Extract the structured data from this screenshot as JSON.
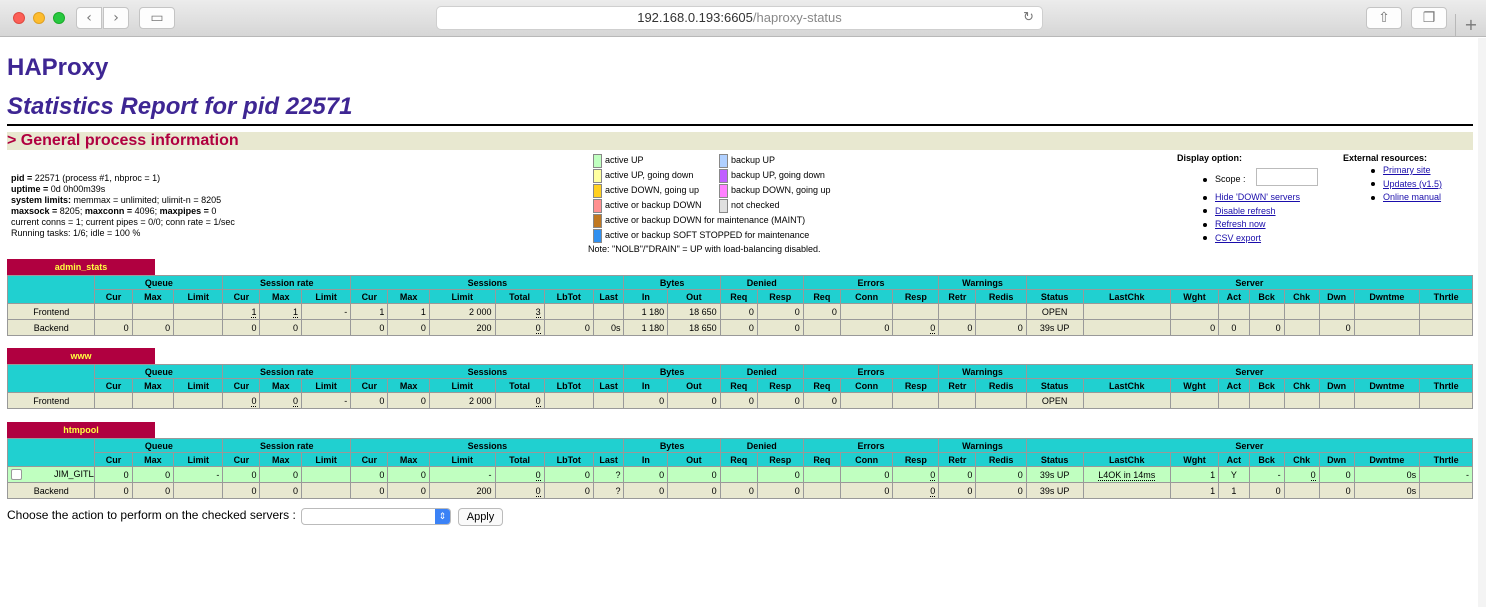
{
  "browser": {
    "url_host": "192.168.0.193:6605",
    "url_path": "/haproxy-status"
  },
  "page": {
    "title": "HAProxy",
    "subtitle": "Statistics Report for pid 22571",
    "section_title": "> General process information"
  },
  "process": {
    "line1_bold": "pid = ",
    "line1": "22571 (process #1, nbproc = 1)",
    "line2_bold": "uptime = ",
    "line2": "0d 0h00m39s",
    "line3_bold": "system limits:",
    "line3": " memmax = unlimited; ulimit-n = 8205",
    "line4_bold": "maxsock = ",
    "line4a": "8205; ",
    "line4b_bold": "maxconn = ",
    "line4b": "4096; ",
    "line4c_bold": "maxpipes = ",
    "line4c": "0",
    "line5": "current conns = 1; current pipes = 0/0; conn rate = 1/sec",
    "line6": "Running tasks: 1/6; idle = 100 %"
  },
  "legend": {
    "items_left": [
      {
        "label": "active UP",
        "color": "#c0ffc0"
      },
      {
        "label": "active UP, going down",
        "color": "#ffffa0"
      },
      {
        "label": "active DOWN, going up",
        "color": "#ffd020"
      },
      {
        "label": "active or backup DOWN",
        "color": "#ff9090"
      },
      {
        "label": "active or backup DOWN for maintenance (MAINT)",
        "color": "#c07820"
      },
      {
        "label": "active or backup SOFT STOPPED for maintenance",
        "color": "#3090f0"
      }
    ],
    "items_right": [
      {
        "label": "backup UP",
        "color": "#b0d0ff"
      },
      {
        "label": "backup UP, going down",
        "color": "#c060ff"
      },
      {
        "label": "backup DOWN, going up",
        "color": "#ff80ff"
      },
      {
        "label": "not checked",
        "color": "#e0e0e0"
      }
    ],
    "note": "Note: \"NOLB\"/\"DRAIN\" = UP with load-balancing disabled."
  },
  "display_option": {
    "heading": "Display option:",
    "scope_label": "Scope :",
    "links": [
      "Hide 'DOWN' servers",
      "Disable refresh",
      "Refresh now",
      "CSV export"
    ]
  },
  "external": {
    "heading": "External resources:",
    "links": [
      "Primary site",
      "Updates (v1.5)",
      "Online manual"
    ]
  },
  "headers": {
    "groups_full": [
      "Queue",
      "Session rate",
      "Sessions",
      "Bytes",
      "Denied",
      "Errors",
      "Warnings",
      "Server"
    ],
    "sub_queue": [
      "Cur",
      "Max",
      "Limit"
    ],
    "sub_rate": [
      "Cur",
      "Max",
      "Limit"
    ],
    "sub_sessions": [
      "Cur",
      "Max",
      "Limit",
      "Total",
      "LbTot",
      "Last"
    ],
    "sub_bytes": [
      "In",
      "Out"
    ],
    "sub_denied": [
      "Req",
      "Resp"
    ],
    "sub_errors": [
      "Req",
      "Conn",
      "Resp"
    ],
    "sub_warnings": [
      "Retr",
      "Redis"
    ],
    "sub_server": [
      "Status",
      "LastChk",
      "Wght",
      "Act",
      "Bck",
      "Chk",
      "Dwn",
      "Dwntme",
      "Thrtle"
    ]
  },
  "proxies": [
    {
      "name": "admin_stats",
      "rows": [
        [
          "Frontend",
          "",
          "",
          "",
          "1",
          "1",
          "-",
          "1",
          "1",
          "2 000",
          "3",
          "",
          "",
          "1 180",
          "18 650",
          "0",
          "0",
          "0",
          "",
          "",
          "",
          "",
          "OPEN",
          "",
          "",
          "",
          "",
          "",
          "",
          "",
          ""
        ],
        [
          "Backend",
          "0",
          "0",
          "",
          "0",
          "0",
          "",
          "0",
          "0",
          "200",
          "0",
          "0",
          "0s",
          "1 180",
          "18 650",
          "0",
          "0",
          "",
          "0",
          "0",
          "0",
          "0",
          "39s UP",
          "",
          "0",
          "0",
          "0",
          "",
          "0",
          "",
          ""
        ]
      ]
    },
    {
      "name": "www",
      "rows": [
        [
          "Frontend",
          "",
          "",
          "",
          "0",
          "0",
          "-",
          "0",
          "0",
          "2 000",
          "0",
          "",
          "",
          "0",
          "0",
          "0",
          "0",
          "0",
          "",
          "",
          "",
          "",
          "OPEN",
          "",
          "",
          "",
          "",
          "",
          "",
          "",
          ""
        ]
      ]
    },
    {
      "name": "htmpool",
      "rows": [
        [
          "JIM_GITLAB",
          "0",
          "0",
          "-",
          "0",
          "0",
          "",
          "0",
          "0",
          "-",
          "0",
          "0",
          "?",
          "0",
          "0",
          "",
          "0",
          "",
          "0",
          "0",
          "0",
          "0",
          "39s UP",
          "L4OK in 14ms",
          "1",
          "Y",
          "-",
          "0",
          "0",
          "0s",
          "-"
        ],
        [
          "Backend",
          "0",
          "0",
          "",
          "0",
          "0",
          "",
          "0",
          "0",
          "200",
          "0",
          "0",
          "?",
          "0",
          "0",
          "0",
          "0",
          "",
          "0",
          "0",
          "0",
          "0",
          "39s UP",
          "",
          "1",
          "1",
          "0",
          "",
          "0",
          "0s",
          ""
        ]
      ]
    }
  ],
  "action": {
    "label": "Choose the action to perform on the checked servers :",
    "apply": "Apply"
  }
}
